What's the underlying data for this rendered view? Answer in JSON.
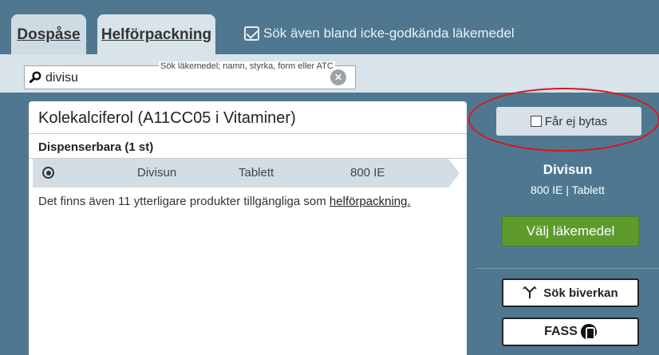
{
  "tabs": [
    {
      "label": "Dospåse"
    },
    {
      "label": "Helförpackning"
    }
  ],
  "search_all_checkbox": {
    "label": "Sök även bland icke-godkända läkemedel",
    "checked": true
  },
  "search": {
    "value": "divisu",
    "placeholder": "Sök läkemedel; namn, styrka, form eller ATC"
  },
  "drug": {
    "title": "Kolekalciferol (A11CC05 i Vitaminer)",
    "section_label": "Dispenserbara (1 st)",
    "selected_row": {
      "name": "Divisun",
      "form": "Tablett",
      "strength": "800 IE"
    },
    "more_text": "Det finns även 11 ytterligare produkter tillgängliga som ",
    "more_link": "helförpackning."
  },
  "right_panel": {
    "substitution_checkbox": {
      "label": "Får ej bytas",
      "checked": false
    },
    "product_name": "Divisun",
    "product_details": "800 IE | Tablett",
    "select_button": "Välj läkemedel",
    "side_effects_button": "Sök biverkan",
    "fass_button": "FASS"
  },
  "colors": {
    "background": "#4f7890",
    "accent_green": "#5e9b2c",
    "highlight_red": "#d8141b"
  }
}
